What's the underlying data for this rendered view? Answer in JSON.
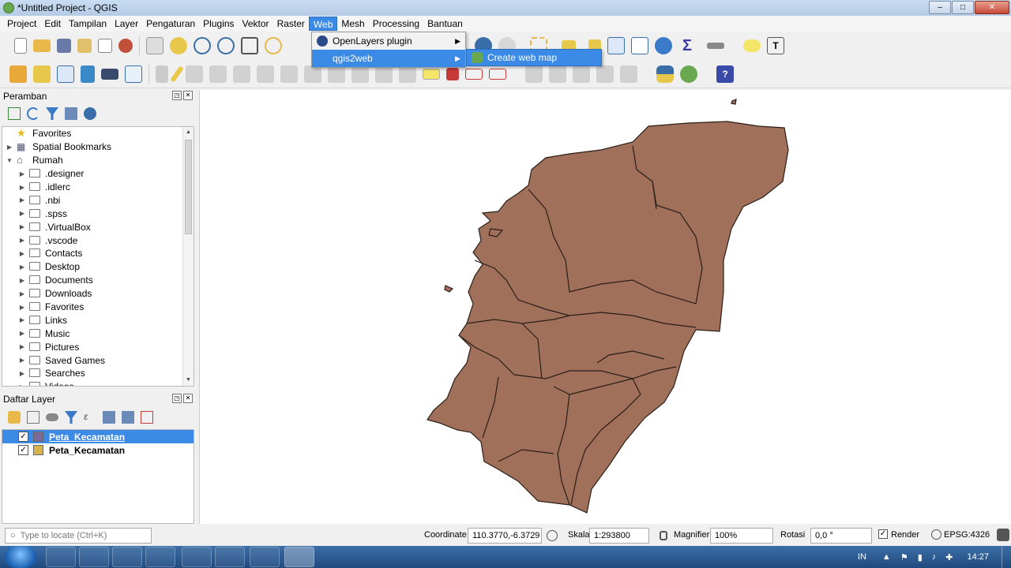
{
  "window": {
    "title": "*Untitled Project - QGIS",
    "minimize": "–",
    "maximize": "□",
    "close": "✕"
  },
  "menubar": {
    "items": [
      "Project",
      "Edit",
      "Tampilan",
      "Layer",
      "Pengaturan",
      "Plugins",
      "Vektor",
      "Raster",
      "Web",
      "Mesh",
      "Processing",
      "Bantuan"
    ]
  },
  "web_menu": {
    "items": [
      {
        "label": "OpenLayers plugin",
        "icon": "openlayers-icon"
      },
      {
        "label": "qgis2web",
        "icon": "qgis2web-icon"
      }
    ],
    "submenu": {
      "label": "Create web map",
      "icon": "qgis2web-icon"
    }
  },
  "browser_panel": {
    "title": "Peramban",
    "items": [
      {
        "label": "Favorites",
        "icon": "star-icon",
        "level": 0
      },
      {
        "label": "Spatial Bookmarks",
        "icon": "bookmark-icon",
        "level": 0
      },
      {
        "label": "Rumah",
        "icon": "home-icon",
        "level": 0
      },
      {
        "label": ".designer",
        "icon": "folder-icon",
        "level": 1
      },
      {
        "label": ".idlerc",
        "icon": "folder-icon",
        "level": 1
      },
      {
        "label": ".nbi",
        "icon": "folder-icon",
        "level": 1
      },
      {
        "label": ".spss",
        "icon": "folder-icon",
        "level": 1
      },
      {
        "label": ".VirtualBox",
        "icon": "folder-icon",
        "level": 1
      },
      {
        "label": ".vscode",
        "icon": "folder-icon",
        "level": 1
      },
      {
        "label": "Contacts",
        "icon": "folder-icon",
        "level": 1
      },
      {
        "label": "Desktop",
        "icon": "folder-icon",
        "level": 1
      },
      {
        "label": "Documents",
        "icon": "folder-icon",
        "level": 1
      },
      {
        "label": "Downloads",
        "icon": "folder-icon",
        "level": 1
      },
      {
        "label": "Favorites",
        "icon": "folder-icon",
        "level": 1
      },
      {
        "label": "Links",
        "icon": "folder-icon",
        "level": 1
      },
      {
        "label": "Music",
        "icon": "folder-icon",
        "level": 1
      },
      {
        "label": "Pictures",
        "icon": "folder-icon",
        "level": 1
      },
      {
        "label": "Saved Games",
        "icon": "folder-icon",
        "level": 1
      },
      {
        "label": "Searches",
        "icon": "folder-icon",
        "level": 1
      },
      {
        "label": "Videos",
        "icon": "folder-icon",
        "level": 1
      }
    ]
  },
  "layers_panel": {
    "title": "Daftar Layer",
    "layers": [
      {
        "name": "Peta_Kecamatan",
        "checked": true,
        "selected": true,
        "color": "#7a6a9a"
      },
      {
        "name": "Peta_Kecamatan",
        "checked": true,
        "selected": false,
        "color": "#d9b44a"
      }
    ]
  },
  "map": {
    "fill_color": "#a0705a",
    "stroke_color": "#2a1e18"
  },
  "statusbar": {
    "locate_placeholder": "Type to locate (Ctrl+K)",
    "coordinate_label": "Coordinate",
    "coordinate_value": "110.3770,-6.3729",
    "scale_label": "Skala",
    "scale_value": "1:293800",
    "magnifier_label": "Magnifier",
    "magnifier_value": "100%",
    "rotation_label": "Rotasi",
    "rotation_value": "0,0 °",
    "render_label": "Render",
    "crs_label": "EPSG:4326"
  },
  "taskbar": {
    "lang": "IN",
    "time": "14:27"
  }
}
